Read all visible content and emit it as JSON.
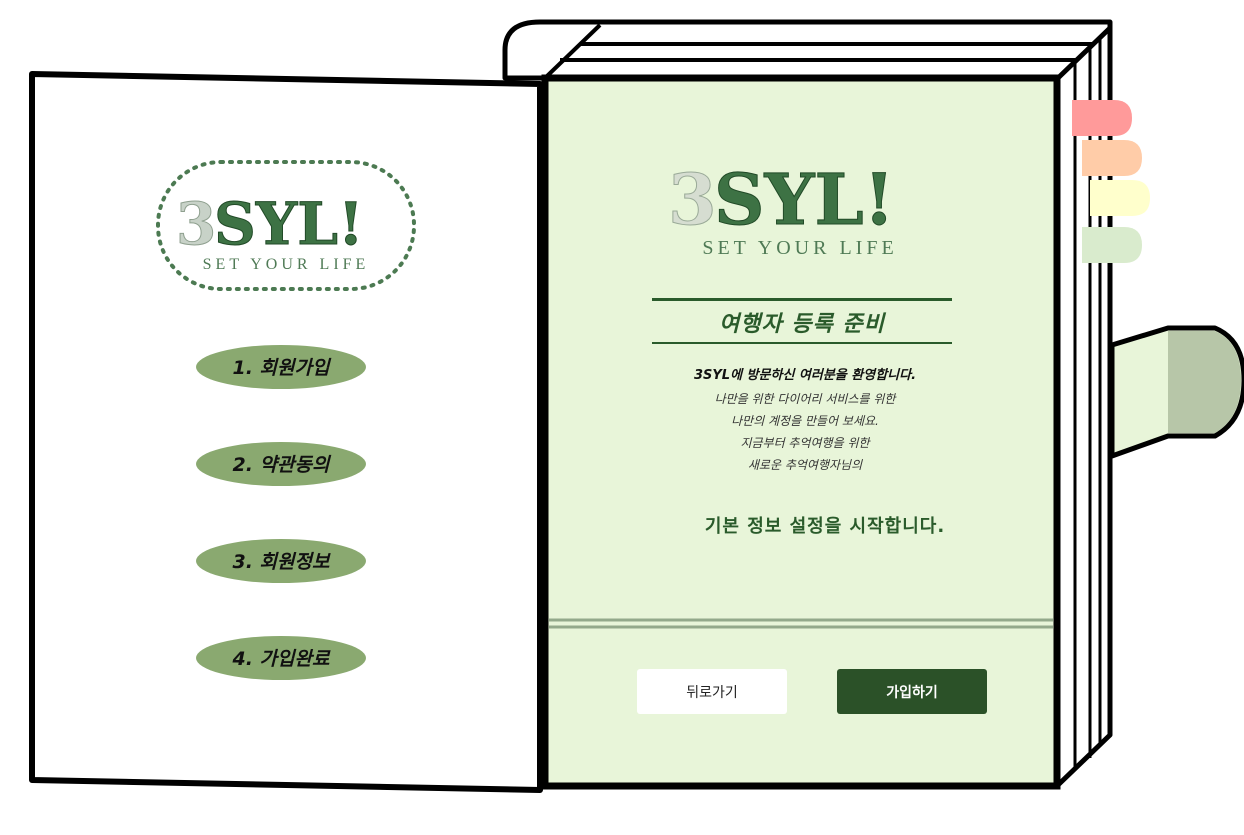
{
  "logo": {
    "digit": "3",
    "letters": "SYL!",
    "tagline": "SET YOUR LIFE"
  },
  "steps": [
    {
      "label": "1. 회원가입"
    },
    {
      "label": "2. 약관동의"
    },
    {
      "label": "3. 회원정보"
    },
    {
      "label": "4. 가입완료"
    }
  ],
  "content": {
    "title": "여행자 등록 준비",
    "welcome": "3SYL에 방문하신 여러분을 환영합니다.",
    "lines": [
      "나만을 위한 다이어리 서비스를 위한",
      "나만의 계정을 만들어 보세요.",
      "지금부터 추억여행을 위한",
      "새로운 추억여행자님의"
    ],
    "start": "기본 정보 설정을 시작합니다."
  },
  "buttons": {
    "back": "뒤로가기",
    "join": "가입하기"
  },
  "colors": {
    "page_green": "#e8f5d9",
    "step_pill": "#8aa970",
    "accent_dark": "#2b5128",
    "tab_red": "#ff9a9a",
    "tab_peach": "#ffcca8",
    "tab_yellow": "#ffffcc",
    "tab_green": "#d9ebcd",
    "clasp_green": "#b7c6a8"
  }
}
